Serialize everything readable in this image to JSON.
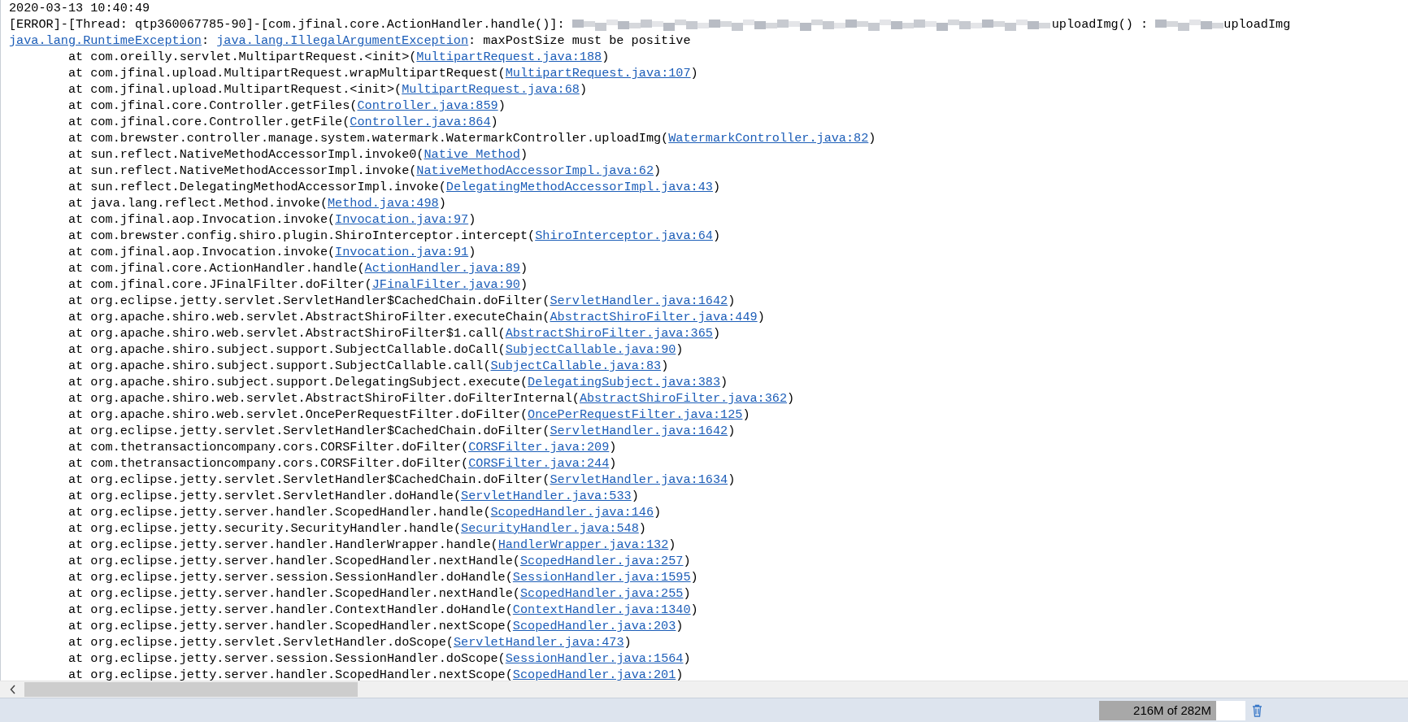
{
  "log": {
    "timestamp": "2020-03-13 10:40:49",
    "error_line": [
      {
        "kind": "text",
        "text": "[ERROR]-[Thread: qtp360067785-90]-[com.jfinal.core.ActionHandler.handle()]: "
      },
      {
        "kind": "redacted_long"
      },
      {
        "kind": "text",
        "text": "uploadImg() : "
      },
      {
        "kind": "redacted_short"
      },
      {
        "kind": "text",
        "text": "uploadImg"
      }
    ],
    "exception": {
      "exception_link": "java.lang.RuntimeException",
      "separator": ": ",
      "cause_link": "java.lang.IllegalArgumentException",
      "message": ": maxPostSize must be positive"
    },
    "frames": [
      {
        "call": "at com.oreilly.servlet.MultipartRequest.<init>(",
        "source": "MultipartRequest.java:188",
        "close": ")"
      },
      {
        "call": "at com.jfinal.upload.MultipartRequest.wrapMultipartRequest(",
        "source": "MultipartRequest.java:107",
        "close": ")"
      },
      {
        "call": "at com.jfinal.upload.MultipartRequest.<init>(",
        "source": "MultipartRequest.java:68",
        "close": ")"
      },
      {
        "call": "at com.jfinal.core.Controller.getFiles(",
        "source": "Controller.java:859",
        "close": ")"
      },
      {
        "call": "at com.jfinal.core.Controller.getFile(",
        "source": "Controller.java:864",
        "close": ")"
      },
      {
        "call": "at com.brewster.controller.manage.system.watermark.WatermarkController.uploadImg(",
        "source": "WatermarkController.java:82",
        "close": ")"
      },
      {
        "call": "at sun.reflect.NativeMethodAccessorImpl.invoke0(",
        "source": "Native Method",
        "close": ")"
      },
      {
        "call": "at sun.reflect.NativeMethodAccessorImpl.invoke(",
        "source": "NativeMethodAccessorImpl.java:62",
        "close": ")"
      },
      {
        "call": "at sun.reflect.DelegatingMethodAccessorImpl.invoke(",
        "source": "DelegatingMethodAccessorImpl.java:43",
        "close": ")"
      },
      {
        "call": "at java.lang.reflect.Method.invoke(",
        "source": "Method.java:498",
        "close": ")"
      },
      {
        "call": "at com.jfinal.aop.Invocation.invoke(",
        "source": "Invocation.java:97",
        "close": ")"
      },
      {
        "call": "at com.brewster.config.shiro.plugin.ShiroInterceptor.intercept(",
        "source": "ShiroInterceptor.java:64",
        "close": ")"
      },
      {
        "call": "at com.jfinal.aop.Invocation.invoke(",
        "source": "Invocation.java:91",
        "close": ")"
      },
      {
        "call": "at com.jfinal.core.ActionHandler.handle(",
        "source": "ActionHandler.java:89",
        "close": ")"
      },
      {
        "call": "at com.jfinal.core.JFinalFilter.doFilter(",
        "source": "JFinalFilter.java:90",
        "close": ")"
      },
      {
        "call": "at org.eclipse.jetty.servlet.ServletHandler$CachedChain.doFilter(",
        "source": "ServletHandler.java:1642",
        "close": ")"
      },
      {
        "call": "at org.apache.shiro.web.servlet.AbstractShiroFilter.executeChain(",
        "source": "AbstractShiroFilter.java:449",
        "close": ")"
      },
      {
        "call": "at org.apache.shiro.web.servlet.AbstractShiroFilter$1.call(",
        "source": "AbstractShiroFilter.java:365",
        "close": ")"
      },
      {
        "call": "at org.apache.shiro.subject.support.SubjectCallable.doCall(",
        "source": "SubjectCallable.java:90",
        "close": ")"
      },
      {
        "call": "at org.apache.shiro.subject.support.SubjectCallable.call(",
        "source": "SubjectCallable.java:83",
        "close": ")"
      },
      {
        "call": "at org.apache.shiro.subject.support.DelegatingSubject.execute(",
        "source": "DelegatingSubject.java:383",
        "close": ")"
      },
      {
        "call": "at org.apache.shiro.web.servlet.AbstractShiroFilter.doFilterInternal(",
        "source": "AbstractShiroFilter.java:362",
        "close": ")"
      },
      {
        "call": "at org.apache.shiro.web.servlet.OncePerRequestFilter.doFilter(",
        "source": "OncePerRequestFilter.java:125",
        "close": ")"
      },
      {
        "call": "at org.eclipse.jetty.servlet.ServletHandler$CachedChain.doFilter(",
        "source": "ServletHandler.java:1642",
        "close": ")"
      },
      {
        "call": "at com.thetransactioncompany.cors.CORSFilter.doFilter(",
        "source": "CORSFilter.java:209",
        "close": ")"
      },
      {
        "call": "at com.thetransactioncompany.cors.CORSFilter.doFilter(",
        "source": "CORSFilter.java:244",
        "close": ")"
      },
      {
        "call": "at org.eclipse.jetty.servlet.ServletHandler$CachedChain.doFilter(",
        "source": "ServletHandler.java:1634",
        "close": ")"
      },
      {
        "call": "at org.eclipse.jetty.servlet.ServletHandler.doHandle(",
        "source": "ServletHandler.java:533",
        "close": ")"
      },
      {
        "call": "at org.eclipse.jetty.server.handler.ScopedHandler.handle(",
        "source": "ScopedHandler.java:146",
        "close": ")"
      },
      {
        "call": "at org.eclipse.jetty.security.SecurityHandler.handle(",
        "source": "SecurityHandler.java:548",
        "close": ")"
      },
      {
        "call": "at org.eclipse.jetty.server.handler.HandlerWrapper.handle(",
        "source": "HandlerWrapper.java:132",
        "close": ")"
      },
      {
        "call": "at org.eclipse.jetty.server.handler.ScopedHandler.nextHandle(",
        "source": "ScopedHandler.java:257",
        "close": ")"
      },
      {
        "call": "at org.eclipse.jetty.server.session.SessionHandler.doHandle(",
        "source": "SessionHandler.java:1595",
        "close": ")"
      },
      {
        "call": "at org.eclipse.jetty.server.handler.ScopedHandler.nextHandle(",
        "source": "ScopedHandler.java:255",
        "close": ")"
      },
      {
        "call": "at org.eclipse.jetty.server.handler.ContextHandler.doHandle(",
        "source": "ContextHandler.java:1340",
        "close": ")"
      },
      {
        "call": "at org.eclipse.jetty.server.handler.ScopedHandler.nextScope(",
        "source": "ScopedHandler.java:203",
        "close": ")"
      },
      {
        "call": "at org.eclipse.jetty.servlet.ServletHandler.doScope(",
        "source": "ServletHandler.java:473",
        "close": ")"
      },
      {
        "call": "at org.eclipse.jetty.server.session.SessionHandler.doScope(",
        "source": "SessionHandler.java:1564",
        "close": ")"
      },
      {
        "call": "at org.eclipse.jetty.server.handler.ScopedHandler.nextScope(",
        "source": "ScopedHandler.java:201",
        "close": ")"
      }
    ]
  },
  "status_bar": {
    "memory": {
      "reading": "216M of 282M",
      "level": 0.8
    }
  }
}
